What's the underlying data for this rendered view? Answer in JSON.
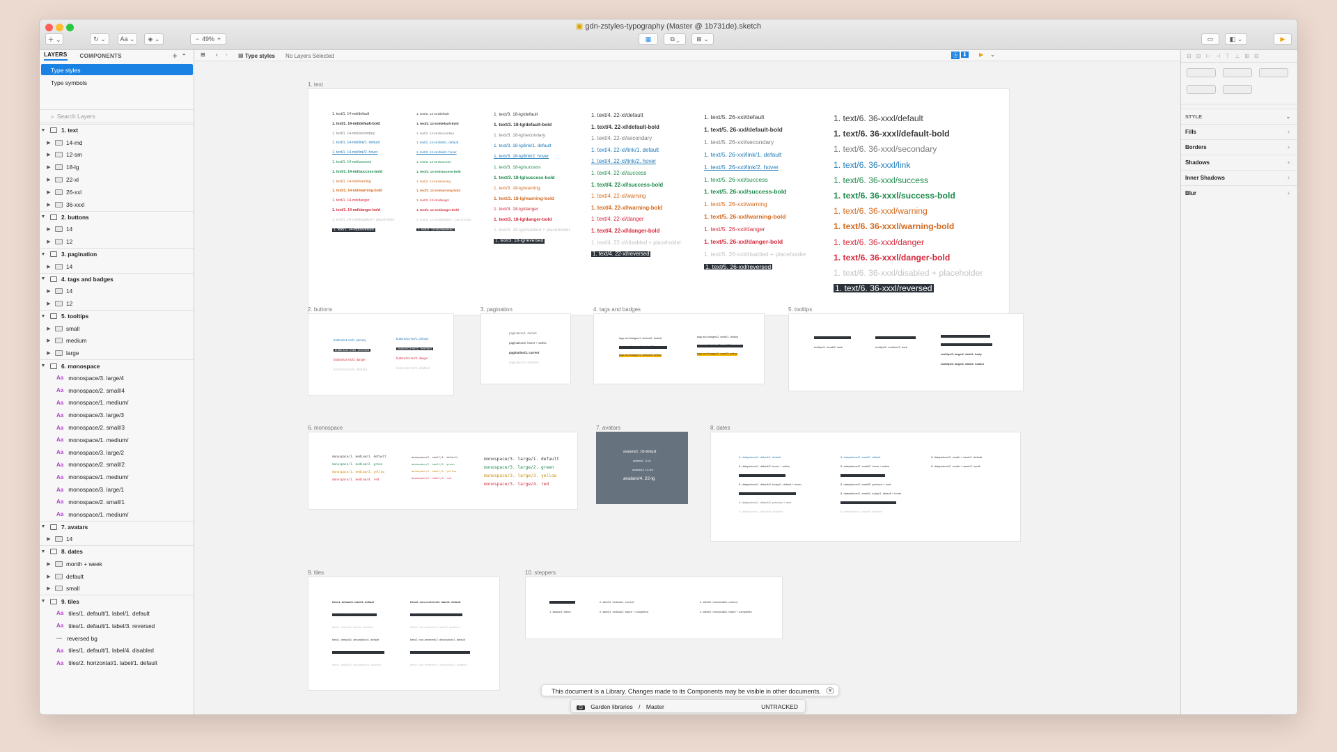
{
  "window": {
    "title": "gdn-zstyles-typography (Master @ 1b731de).sketch"
  },
  "toolbar": {
    "zoom": "49%"
  },
  "left": {
    "tabs": [
      "LAYERS",
      "COMPONENTS"
    ],
    "pages": [
      "Type styles",
      "Type symbols"
    ],
    "search_placeholder": "Search Layers",
    "rows": [
      {
        "k": "g",
        "label": "1. text"
      },
      {
        "k": "f",
        "label": "14-md"
      },
      {
        "k": "f",
        "label": "12-sm"
      },
      {
        "k": "f",
        "label": "18-lg"
      },
      {
        "k": "f",
        "label": "22-xl"
      },
      {
        "k": "f",
        "label": "26-xxl"
      },
      {
        "k": "f",
        "label": "36-xxxl"
      },
      {
        "k": "g",
        "label": "2. buttons"
      },
      {
        "k": "f",
        "label": "14"
      },
      {
        "k": "f",
        "label": "12"
      },
      {
        "k": "g",
        "label": "3. pagination"
      },
      {
        "k": "f",
        "label": "14"
      },
      {
        "k": "g",
        "label": "4. tags and badges"
      },
      {
        "k": "f",
        "label": "14"
      },
      {
        "k": "f",
        "label": "12"
      },
      {
        "k": "g",
        "label": "5. tooltips"
      },
      {
        "k": "f",
        "label": "small"
      },
      {
        "k": "f",
        "label": "medium"
      },
      {
        "k": "f",
        "label": "large"
      },
      {
        "k": "g",
        "label": "6. monospace"
      },
      {
        "k": "s",
        "label": "monospace/3. large/4"
      },
      {
        "k": "s",
        "label": "monospace/2. small/4"
      },
      {
        "k": "s",
        "label": "monospace/1. medium/"
      },
      {
        "k": "s",
        "label": "monospace/3. large/3"
      },
      {
        "k": "s",
        "label": "monospace/2. small/3"
      },
      {
        "k": "s",
        "label": "monospace/1. medium/"
      },
      {
        "k": "s",
        "label": "monospace/3. large/2"
      },
      {
        "k": "s",
        "label": "monospace/2. small/2"
      },
      {
        "k": "s",
        "label": "monospace/1. medium/"
      },
      {
        "k": "s",
        "label": "monospace/3. large/1"
      },
      {
        "k": "s",
        "label": "monospace/2. small/1"
      },
      {
        "k": "s",
        "label": "monospace/1. medium/"
      },
      {
        "k": "g",
        "label": "7. avatars"
      },
      {
        "k": "f",
        "label": "14"
      },
      {
        "k": "g",
        "label": "8. dates"
      },
      {
        "k": "f",
        "label": "month + week"
      },
      {
        "k": "f",
        "label": "default"
      },
      {
        "k": "f",
        "label": "small"
      },
      {
        "k": "g",
        "label": "9. tiles"
      },
      {
        "k": "s",
        "label": "tiles/1. default/1. label/1. default"
      },
      {
        "k": "s",
        "label": "tiles/1. default/1. label/3. reversed"
      },
      {
        "k": "l",
        "label": "reversed bg"
      },
      {
        "k": "s",
        "label": "tiles/1. default/1. label/4. disabled"
      },
      {
        "k": "s",
        "label": "tiles/2. horizontal/1. label/1. default"
      }
    ]
  },
  "crumb": {
    "page": "Type styles",
    "status": "No Layers Selected"
  },
  "colors": {
    "default": "#3a3a3a",
    "secondary": "#7a7a7a",
    "link": "#1f7ab8",
    "success": "#1d8a4c",
    "warning": "#d2691e",
    "danger": "#d42a3c",
    "ph": "#c4c4c4"
  },
  "artboards": {
    "text": {
      "label": "1. text",
      "cols": [
        [
          "1. text/1. 14-md/default",
          "1. text/1. 14-md/default-bold",
          "1. text/1. 14-md/secondary",
          "1. text/1. 14-md/link/1. default",
          "1. text/1. 14-md/link/2. hover",
          "1. text/1. 14-md/success",
          "1. text/1. 14-md/success-bold",
          "1. text/1. 14-md/warning",
          "1. text/1. 14-md/warning-bold",
          "1. text/1. 14-md/danger",
          "1. text/1. 14-md/danger-bold",
          "1. text/1. 14-md/disabled + placeholder",
          "1. text/1. 14-md/reversed"
        ],
        [
          "1. text/2. 12-sm/default",
          "1. text/2. 12-sm/default-bold",
          "1. text/2. 12-sm/secondary",
          "1. text/2. 12-sm/link/1. default",
          "1. text/2. 12-sm/link/2. hover",
          "1. text/2. 12-sm/success",
          "1. text/2. 12-sm/success-bold",
          "1. text/2. 12-sm/warning",
          "1. text/2. 12-sm/warning-bold",
          "1. text/2. 12-sm/danger",
          "1. text/2. 12-sm/danger-bold",
          "1. text/2. 12-sm/disabled + placeholder",
          "1. text/2. 12-sm/reversed"
        ],
        [
          "1. text/3. 18-lg/default",
          "1. text/3. 18-lg/default-bold",
          "1. text/3. 18-lg/secondary",
          "1. text/3. 18-lg/link/1. default",
          "1. text/3. 18-lg/link/2. hover",
          "1. text/3. 18-lg/success",
          "1. text/3. 18-lg/success-bold",
          "1. text/3. 18-lg/warning",
          "1. text/3. 18-lg/warning-bold",
          "1. text/3. 18-lg/danger",
          "1. text/3. 18-lg/danger-bold",
          "1. text/3. 18-lg/disabled + placeholder",
          "1. text/3. 18-lg/reversed"
        ],
        [
          "1. text/4. 22-xl/default",
          "1. text/4. 22-xl/default-bold",
          "1. text/4. 22-xl/secondary",
          "1. text/4. 22-xl/link/1. default",
          "1. text/4. 22-xl/link/2. hover",
          "1. text/4. 22-xl/success",
          "1. text/4. 22-xl/success-bold",
          "1. text/4. 22-xl/warning",
          "1. text/4. 22-xl/warning-bold",
          "1. text/4. 22-xl/danger",
          "1. text/4. 22-xl/danger-bold",
          "1. text/4. 22-xl/disabled + placeholder",
          "1. text/4. 22-xl/reversed"
        ],
        [
          "1. text/5. 26-xxl/default",
          "1. text/5. 26-xxl/default-bold",
          "1. text/5. 26-xxl/secondary",
          "1. text/5. 26-xxl/link/1. default",
          "1. text/5. 26-xxl/link/2. hover",
          "1. text/5. 26-xxl/success",
          "1. text/5. 26-xxl/success-bold",
          "1. text/5. 26-xxl/warning",
          "1. text/5. 26-xxl/warning-bold",
          "1. text/5. 26-xxl/danger",
          "1. text/5. 26-xxl/danger-bold",
          "1. text/5. 26-xxl/disabled + placeholder",
          "1. text/5. 26-xxl/reversed"
        ],
        [
          "1. text/6. 36-xxxl/default",
          "1. text/6. 36-xxxl/default-bold",
          "1. text/6. 36-xxxl/secondary",
          "1. text/6. 36-xxxl/link",
          "1. text/6. 36-xxxl/success",
          "1. text/6. 36-xxxl/success-bold",
          "1. text/6. 36-xxxl/warning",
          "1. text/6. 36-xxxl/warning-bold",
          "1. text/6. 36-xxxl/danger",
          "1. text/6. 36-xxxl/danger-bold",
          "1. text/6. 36-xxxl/disabled + placeholder",
          "1. text/6. 36-xxxl/reversed"
        ]
      ]
    },
    "buttons": {
      "label": "2. buttons",
      "items": [
        "buttons/14-md/1. primary",
        "buttons/14-md/2. reversed",
        "buttons/14-md/3. danger",
        "buttons/14-md/4. disabled",
        "buttons/12-sm/1. primary",
        "buttons/12-sm/2. reversed",
        "buttons/12-sm/3. danger",
        "buttons/12-sm/4. disabled"
      ]
    },
    "pagination": {
      "label": "3. pagination",
      "items": [
        "pagination/1. default",
        "pagination/2. hover + active",
        "pagination/3. current",
        "pagination/4. disabled"
      ]
    },
    "tags": {
      "label": "4. tags and badges",
      "items": [
        "tags and badges/1. default/1. default",
        "tags and badges/1. default/2. reversed",
        "tags and badges/1. default/3. yellow",
        "tags and badges/2. small/1. default",
        "tags and badges/2. small/2. reversed",
        "tags and badges/2. small/3. yellow"
      ]
    },
    "tooltips": {
      "label": "5. tooltips",
      "items": [
        "tooltips/1. small/1. reversed",
        "tooltips/1. small/2. dark",
        "tooltips/2. medium/1. reversed",
        "tooltips/2. medium/2. dark",
        "tooltips/3. large/1. reversed/1. body",
        "tooltips/3. large/1. reversed/2. header",
        "tooltips/3. large/2. dark/1. body",
        "tooltips/3. large/2. dark/2. header"
      ]
    },
    "monospace": {
      "label": "6. monospace",
      "items": [
        "monospace/1. medium/1. default",
        "monospace/1. medium/2. green",
        "monospace/1. medium/3. yellow",
        "monospace/1. medium/4. red",
        "monospace/2. small/1. default",
        "monospace/2. small/2. green",
        "monospace/2. small/3. yellow",
        "monospace/2. small/4. red",
        "monospace/3. large/1. default",
        "monospace/3. large/2. green",
        "monospace/3. large/3. yellow",
        "monospace/3. large/4. red"
      ]
    },
    "avatars": {
      "label": "7. avatars",
      "items": [
        "avatars/1. 18-default",
        "avatars/2. 12-xs",
        "avatars/3. 14-sm",
        "avatars/4. 22-lg"
      ]
    },
    "dates": {
      "label": "8. dates",
      "items": [
        "8. datepickers/1. default/1. default",
        "8. datepickers/1. default/2. hover + active",
        "8. datepickers/1. default/3. selected",
        "8. datepickers/1. default/4. today/1. default + hover",
        "8. datepickers/1. default/4. today/2. selected",
        "8. datepickers/1. default/5. previous + next",
        "8. datepickers/1. default/6. disabled",
        "8. datepickers/2. small/1. default",
        "8. datepickers/2. small/2. hover + active",
        "8. datepickers/2. small/3. selected",
        "8. datepickers/2. small/5. previous + next",
        "8. datepickers/2. small/4. today/1. default + hover",
        "8. datepickers/2. small/4. today/2. selected",
        "8. datepickers/2. small/6. disabled",
        "8. datepickers/3. month + week/1. default",
        "8. datepickers/3. month + week/2. small"
      ]
    },
    "tiles": {
      "label": "9. tiles",
      "items": [
        "tiles/1. default/1. label/1. default",
        "tiles/1. default/1. label/3. reversed",
        "tiles/1. default/1. label/4. disabled",
        "tiles/1. default/2. description/1. default",
        "tiles/1. default/2. description/2. reversed",
        "tiles/1. default/2. description/3. disabled",
        "tiles/2. non-centered/1. label/1. default",
        "tiles/2. non-centered/1. label/4. reversed",
        "tiles/2. non-centered/1. label/3. disabled",
        "tiles/2. non-centered/2. description/1. default",
        "tiles/2. non-centered/2. description/2. reversed",
        "tiles/2. non-centered/2. description/3. disabled"
      ]
    },
    "steppers": {
      "label": "10. steppers",
      "items": [
        "1. status/2. current",
        "1. status/3. future",
        "2. label/1. vertical/1. current",
        "2. label/1. vertical/2. future + completed",
        "2. label/2. horizontal/1. current",
        "2. label/2. horizontal/2. future + completed"
      ]
    }
  },
  "right": {
    "section": "STYLE",
    "rows": [
      "Fills",
      "Borders",
      "Shadows",
      "Inner Shadows",
      "Blur"
    ]
  },
  "notice": {
    "text": "This document is a Library. Changes made to its Components may be visible in other documents.",
    "lib": "Garden libraries",
    "branch": "Master",
    "status": "UNTRACKED"
  }
}
